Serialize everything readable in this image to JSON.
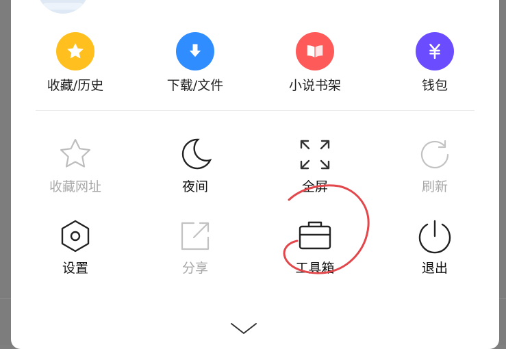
{
  "colors": {
    "favorites_history": "#ffbf1f",
    "downloads_files": "#2f8dff",
    "novel_shelf": "#ff5a5a",
    "wallet": "#6b4cff",
    "annotation_red": "#e2474b"
  },
  "top_row": [
    {
      "label": "收藏/历史",
      "icon": "star-icon"
    },
    {
      "label": "下载/文件",
      "icon": "download-arrow-icon"
    },
    {
      "label": "小说书架",
      "icon": "open-book-icon"
    },
    {
      "label": "钱包",
      "icon": "yuan-icon"
    }
  ],
  "grid": {
    "row1": [
      {
        "label": "收藏网址",
        "icon": "star-outline-icon",
        "enabled": false
      },
      {
        "label": "夜间",
        "icon": "moon-icon",
        "enabled": true
      },
      {
        "label": "全屏",
        "icon": "fullscreen-icon",
        "enabled": true
      },
      {
        "label": "刷新",
        "icon": "refresh-icon",
        "enabled": false
      }
    ],
    "row2": [
      {
        "label": "设置",
        "icon": "settings-hexagon-icon",
        "enabled": true
      },
      {
        "label": "分享",
        "icon": "share-icon",
        "enabled": false
      },
      {
        "label": "工具箱",
        "icon": "toolbox-icon",
        "enabled": true
      },
      {
        "label": "退出",
        "icon": "power-icon",
        "enabled": true
      }
    ]
  },
  "collapse": {
    "icon": "chevron-down-icon"
  }
}
